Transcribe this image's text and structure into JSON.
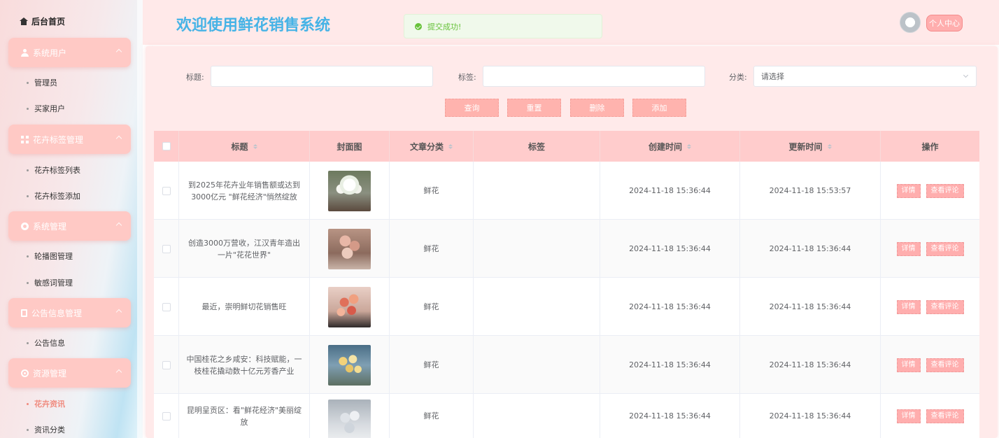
{
  "sidebar": {
    "home": "后台首页",
    "groups": [
      {
        "label": "系统用户",
        "icon": "user-icon",
        "items": [
          "管理员",
          "买家用户"
        ]
      },
      {
        "label": "花卉标签管理",
        "icon": "tags-icon",
        "items": [
          "花卉标签列表",
          "花卉标签添加"
        ]
      },
      {
        "label": "系统管理",
        "icon": "gear-icon",
        "items": [
          "轮播图管理",
          "敏感词管理"
        ]
      },
      {
        "label": "公告信息管理",
        "icon": "document-icon",
        "items": [
          "公告信息"
        ]
      },
      {
        "label": "资源管理",
        "icon": "resource-icon",
        "items": [
          "花卉资讯",
          "资讯分类"
        ]
      }
    ],
    "active_item": "花卉资讯"
  },
  "header": {
    "title": "欢迎使用鲜花销售系统",
    "toast": "提交成功!",
    "personal_center": "个人中心"
  },
  "filters": {
    "title_label": "标题:",
    "tag_label": "标签:",
    "category_label": "分类:",
    "category_placeholder": "请选择",
    "title_value": "",
    "tag_value": ""
  },
  "actions": {
    "search": "查询",
    "reset": "重置",
    "delete": "删除",
    "add": "添加"
  },
  "table": {
    "columns": [
      "标题",
      "封面图",
      "文章分类",
      "标签",
      "创建时间",
      "更新时间",
      "操作"
    ],
    "row_actions": {
      "detail": "详情",
      "comments": "查看评论"
    },
    "rows": [
      {
        "title": "到2025年花卉业年销售额或达到3000亿元 \"鲜花经济\"悄然绽放",
        "category": "鲜花",
        "tags": "",
        "created": "2024-11-18 15:36:44",
        "updated": "2024-11-18 15:53:57"
      },
      {
        "title": "创造3000万营收，江汉青年造出一片\"花花世界\"",
        "category": "鲜花",
        "tags": "",
        "created": "2024-11-18 15:36:44",
        "updated": "2024-11-18 15:36:44"
      },
      {
        "title": "最近，崇明鲜切花销售旺",
        "category": "鲜花",
        "tags": "",
        "created": "2024-11-18 15:36:44",
        "updated": "2024-11-18 15:36:44"
      },
      {
        "title": "中国桂花之乡咸安：科技赋能，一枝桂花撬动数十亿元芳香产业",
        "category": "鲜花",
        "tags": "",
        "created": "2024-11-18 15:36:44",
        "updated": "2024-11-18 15:36:44"
      },
      {
        "title": "昆明呈贡区：看\"鲜花经济\"美丽绽放",
        "category": "鲜花",
        "tags": "",
        "created": "2024-11-18 15:36:44",
        "updated": "2024-11-18 15:36:44"
      }
    ]
  }
}
